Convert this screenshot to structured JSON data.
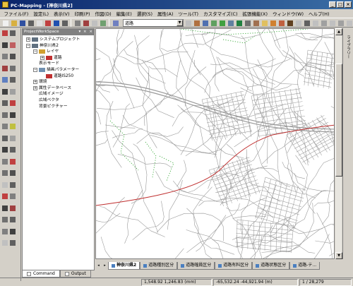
{
  "window": {
    "title": "PC-Mapping - [神奈川県2]",
    "min": "_",
    "max": "□",
    "close": "×"
  },
  "menu": [
    "ファイル(F)",
    "設定(L)",
    "表示(V)",
    "印刷(P)",
    "作図(D)",
    "編集(E)",
    "選択(S)",
    "属性(A)",
    "ツール(T)",
    "カスタマイズ(C)",
    "拡張機能(X)",
    "ウィンドウ(W)",
    "ヘルプ(H)"
  ],
  "toolbar": {
    "layer_select_value": "道路",
    "icon_colors": [
      "#f0f0f0",
      "#d8b040",
      "#3050a0",
      "#606060",
      "#e0e0e0",
      "#c04040",
      "#2050b0",
      "#606060",
      "#808080",
      "#a04040",
      "#c0c0c0",
      "#70a070",
      "#7080c0",
      "#c0c0c0",
      "#b07040",
      "#5070b0",
      "#60a060",
      "#40a040",
      "#6080a0",
      "#208040",
      "#707070",
      "#a07050",
      "#e0c060",
      "#d08030",
      "#c06040",
      "#604020",
      "#c0c0c0",
      "#606060",
      "#c0c0c0",
      "#a0a0a0",
      "#c0c0c0",
      "#a0a0a0",
      "#c0c0c0"
    ]
  },
  "left_tools": {
    "icon_colors": [
      "#c04040",
      "#606060",
      "#404040",
      "#c06060",
      "#808080",
      "#505050",
      "#a04040",
      "#707070",
      "#6080c0",
      "#606060",
      "#404040",
      "#a0a0a0",
      "#606060",
      "#c04040",
      "#707070",
      "#404040",
      "#808080",
      "#c0c040",
      "#606060",
      "#a0a0a0",
      "#404040",
      "#606060",
      "#808080",
      "#c04040",
      "#707070",
      "#505050",
      "#c0c0c0",
      "#606060",
      "#c04040",
      "#808080",
      "#404040",
      "#a04040",
      "#707070",
      "#606060",
      "#808080",
      "#404040",
      "#c0c0c0",
      "#606060"
    ]
  },
  "project_panel": {
    "title": "ProjectWorkSpace",
    "header_buttons": "▾ × ×",
    "tree": [
      {
        "label": "システムプロジェクト",
        "indent": 0,
        "expander": "+",
        "color": "#607080"
      },
      {
        "label": "神奈川県2",
        "indent": 0,
        "expander": "−",
        "color": "#607080"
      },
      {
        "label": "レイヤ",
        "indent": 1,
        "expander": "−",
        "color": "#d0a030"
      },
      {
        "label": "道路",
        "indent": 2,
        "expander": "+",
        "color": "#c03030"
      },
      {
        "label": "表示モード",
        "indent": 1,
        "expander": "",
        "color": ""
      },
      {
        "label": "描画パラメーター",
        "indent": 1,
        "expander": "−",
        "color": "#7090b0"
      },
      {
        "label": "道路IS250",
        "indent": 2,
        "expander": "",
        "color": "#c03030"
      },
      {
        "label": "環境",
        "indent": 1,
        "expander": "+",
        "color": ""
      },
      {
        "label": "属性データベース",
        "indent": 1,
        "expander": "+",
        "color": ""
      },
      {
        "label": "広域イメージ",
        "indent": 1,
        "expander": "",
        "color": ""
      },
      {
        "label": "広域ベクタ",
        "indent": 1,
        "expander": "",
        "color": ""
      },
      {
        "label": "背景ピクチャー",
        "indent": 1,
        "expander": "",
        "color": ""
      }
    ],
    "tabs": [
      "Command",
      "Output"
    ]
  },
  "right_panel": {
    "label": "ライブラリー"
  },
  "map_tabs": {
    "nav": [
      "◂",
      "▸"
    ],
    "tabs": [
      "神奈川県2",
      "道路種別区分",
      "道路幅員区分",
      "道路有料区分",
      "道路状態区分",
      "道路-テ..."
    ]
  },
  "colors": {
    "road": "#9a9a9a",
    "highway": "#c03030",
    "green_path": "#3aaa3a"
  },
  "status": {
    "coords_mm": "1,548.92 1,246.83  (mm)",
    "coords_m": "-65,532.24  -44,921.94  (m)",
    "scale": "1 / 28,279"
  }
}
